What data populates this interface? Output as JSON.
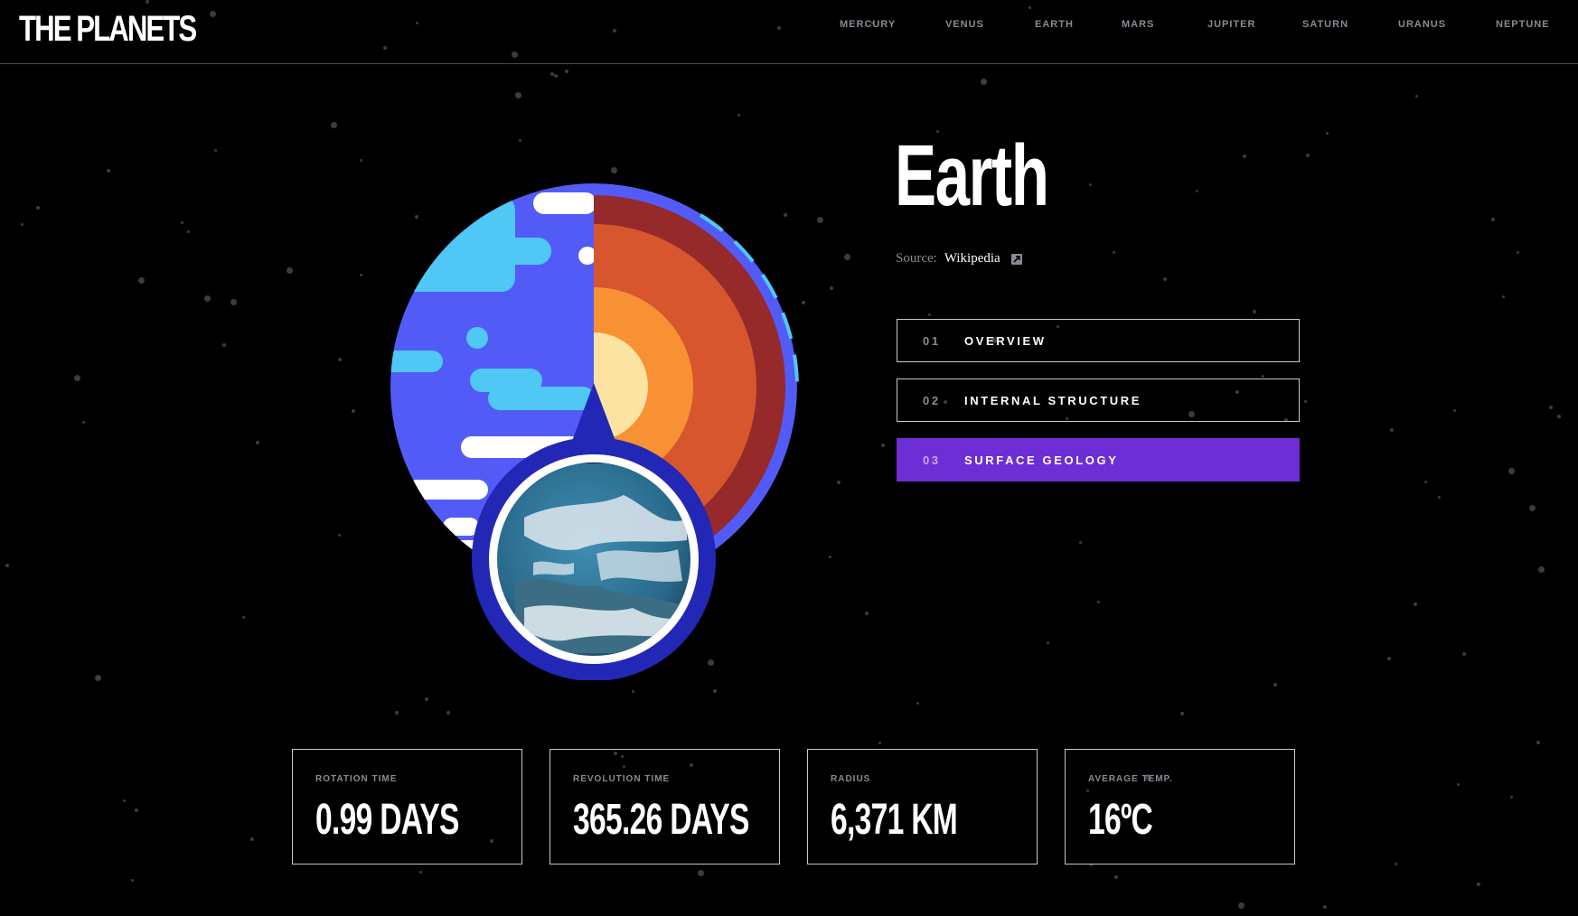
{
  "header": {
    "logo": "THE PLANETS",
    "nav": [
      "MERCURY",
      "VENUS",
      "EARTH",
      "MARS",
      "JUPITER",
      "SATURN",
      "URANUS",
      "NEPTUNE"
    ]
  },
  "planet": {
    "name": "Earth",
    "source_label": "Source:",
    "source_link": "Wikipedia"
  },
  "tabs": [
    {
      "num": "01",
      "label": "OVERVIEW"
    },
    {
      "num": "02",
      "label": "INTERNAL STRUCTURE"
    },
    {
      "num": "03",
      "label": "SURFACE GEOLOGY"
    }
  ],
  "active_tab": "03",
  "stats": [
    {
      "label": "ROTATION TIME",
      "value": "0.99 DAYS"
    },
    {
      "label": "REVOLUTION TIME",
      "value": "365.26 DAYS"
    },
    {
      "label": "RADIUS",
      "value": "6,371 KM"
    },
    {
      "label": "AVERAGE TEMP.",
      "value": "16ºC"
    }
  ],
  "colors": {
    "accent": "#6d2ed5",
    "background": "#000000",
    "ocean": "#535bf7",
    "land": "#4fc8f5"
  }
}
